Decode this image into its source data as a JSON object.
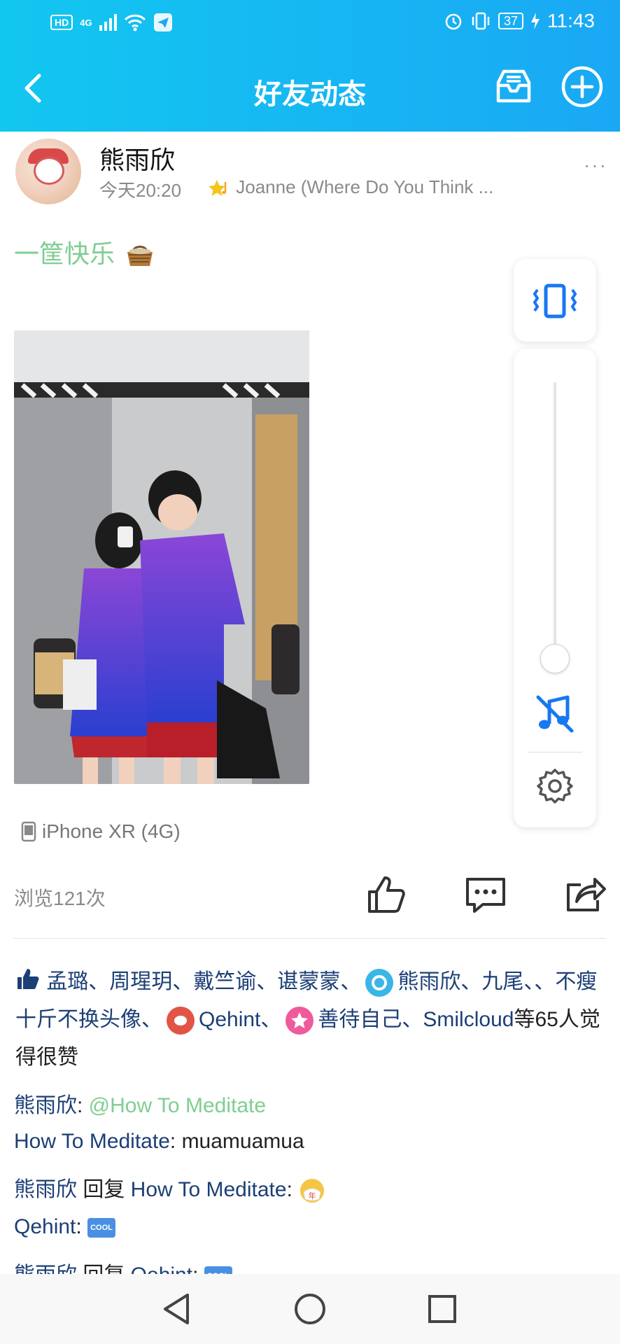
{
  "status_bar": {
    "hd": "HD",
    "network": "4G",
    "time": "11:43",
    "battery": "37"
  },
  "header": {
    "title": "好友动态"
  },
  "post": {
    "author": "熊雨欣",
    "time": "今天20:20",
    "song": "Joanne (Where Do You Think ...",
    "more": "···",
    "caption": "一筐快乐",
    "device": "iPhone XR (4G)",
    "views": "浏览121次"
  },
  "likes": {
    "names_1": "孟璐、周瑆玥、戴竺谕、谌蒙蒙、",
    "name_2": "熊雨欣",
    "names_3": "、九尾、、不瘦十斤不换头像、",
    "name_4": "Qehint",
    "sep_4": "、",
    "name_5": "善待自己",
    "sep_5": "、",
    "name_6": "Smilcloud",
    "suffix": "等65人觉得很赞"
  },
  "comments": [
    {
      "author": "熊雨欣",
      "sep": ": ",
      "mention": "@How To Meditate"
    },
    {
      "author": "How To Meditate",
      "sep": ": ",
      "text": "muamuamua"
    },
    {
      "author": "熊雨欣",
      "reply": " 回复 ",
      "target": "How To Meditate",
      "sep": ": "
    },
    {
      "author": "Qehint",
      "sep": ": ",
      "badge": "COOL"
    },
    {
      "author": "熊雨欣",
      "reply": " 回复 ",
      "target": "Qehint",
      "sep": ": ",
      "badge": "COOL"
    }
  ],
  "colors": {
    "accent": "#1aa8f4",
    "name_blue": "#1c3f75",
    "mention_green": "#7fce92",
    "icon_blue": "#1877f2"
  }
}
